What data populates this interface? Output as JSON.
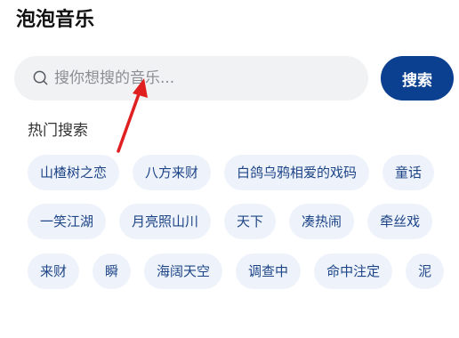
{
  "header": {
    "title": "泡泡音乐"
  },
  "search": {
    "placeholder": "搜你想搜的音乐...",
    "icon": "search-icon",
    "button_label": "搜索"
  },
  "hot_search": {
    "title": "热门搜索",
    "rows": [
      [
        "山楂树之恋",
        "八方来财",
        "白鸽乌鸦相爱的戏码",
        "童话"
      ],
      [
        "一笑江湖",
        "月亮照山川",
        "天下",
        "凑热闹",
        "牵丝戏"
      ],
      [
        "来财",
        "瞬",
        "海阔天空",
        "调查中",
        "命中注定",
        "泥"
      ]
    ]
  },
  "colors": {
    "accent": "#0b3f8f",
    "tag_background": "#eef3fb",
    "tag_text": "#1d4487",
    "search_background": "#f1f2f4",
    "annotation": "#e02020"
  }
}
